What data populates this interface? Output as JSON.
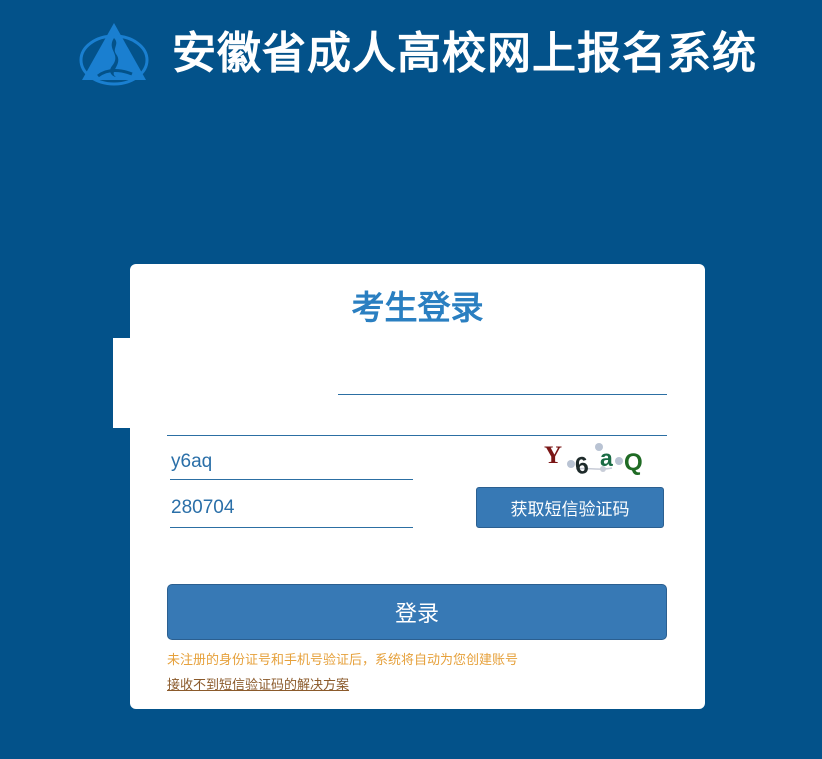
{
  "header": {
    "title": "安徽省成人高校网上报名系统",
    "logo_icon": "flame-triangle-logo",
    "logo_color": "#1a7fd0"
  },
  "login": {
    "title": "考生登录",
    "id_number_value": "",
    "phone_value": "",
    "captcha_value": "y6aq",
    "captcha_image_text": "Y6aQ",
    "sms_code_value": "280704",
    "sms_button_label": "获取短信验证码",
    "submit_label": "登录",
    "notice_text": "未注册的身份证号和手机号验证后，系统将自动为您创建账号",
    "help_link_text": "接收不到短信验证码的解决方案"
  },
  "colors": {
    "background": "#03528a",
    "accent": "#3779b5",
    "title": "#2a7fc1",
    "notice": "#e6a13c"
  }
}
